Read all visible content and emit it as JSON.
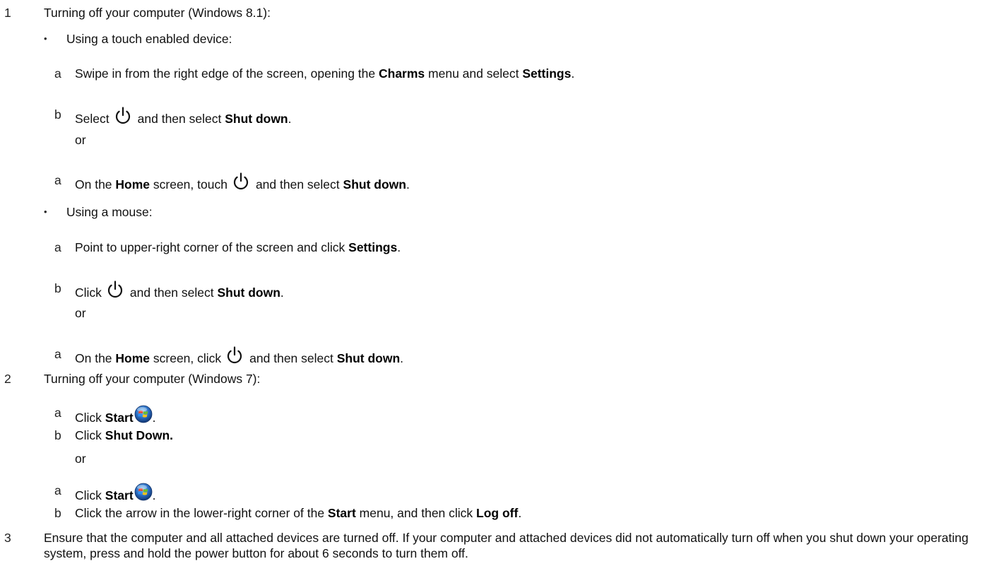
{
  "steps": [
    {
      "num": "1",
      "text": "Turning off your computer (Windows 8.1):",
      "groups": [
        {
          "bullet": "Using a touch enabled device:",
          "a1": {
            "mark": "a",
            "t1": "Swipe in from the right edge of the screen, opening the ",
            "b1": "Charms",
            "t2": " menu and select ",
            "b2": "Settings",
            "t3": "."
          },
          "b": {
            "mark": "b",
            "t1": "Select",
            "t2": "and then select ",
            "b1": "Shut down",
            "t3": "."
          },
          "or": "or",
          "a2": {
            "mark": "a",
            "t1": "On the ",
            "b1": "Home",
            "t2": " screen, touch",
            "t3": "and then select ",
            "b2": "Shut down",
            "t4": "."
          }
        },
        {
          "bullet": "Using a mouse:",
          "a1": {
            "mark": "a",
            "t1": "Point to upper-right corner of the screen and click ",
            "b1": "Settings",
            "t2": "."
          },
          "b": {
            "mark": "b",
            "t1": "Click",
            "t2": "and then select ",
            "b1": "Shut down",
            "t3": "."
          },
          "or": "or",
          "a2": {
            "mark": "a",
            "t1": "On the ",
            "b1": "Home",
            "t2": " screen, click",
            "t3": "and then select ",
            "b2": "Shut down",
            "t4": "."
          }
        }
      ]
    },
    {
      "num": "2",
      "text": "Turning off your computer (Windows 7):",
      "a1": {
        "mark": "a",
        "t1": "Click ",
        "b1": "Start",
        "t2": "."
      },
      "b1": {
        "mark": "b",
        "t1": "Click ",
        "b1": "Shut Down."
      },
      "or": "or",
      "a2": {
        "mark": "a",
        "t1": "Click ",
        "b1": "Start",
        "t2": "."
      },
      "b2": {
        "mark": "b",
        "t1": "Click the arrow in the lower-right corner of the ",
        "b1": "Start",
        "t2": " menu, and then click ",
        "b2": "Log off",
        "t3": "."
      }
    },
    {
      "num": "3",
      "text": "Ensure that the computer and all attached devices are turned off. If your computer and attached devices did not automatically turn off when you shut down your operating system, press and hold the power button for about 6 seconds to turn them off."
    }
  ],
  "bullet_char": "•",
  "icons": {
    "power": "power-icon",
    "start": "windows-start-orb-icon"
  },
  "colors": {
    "text": "#111111",
    "orb_blue": "#1f5fb8",
    "orb_red": "#e8452c",
    "orb_green": "#6cbf2a",
    "orb_yellow": "#f6c21b"
  }
}
